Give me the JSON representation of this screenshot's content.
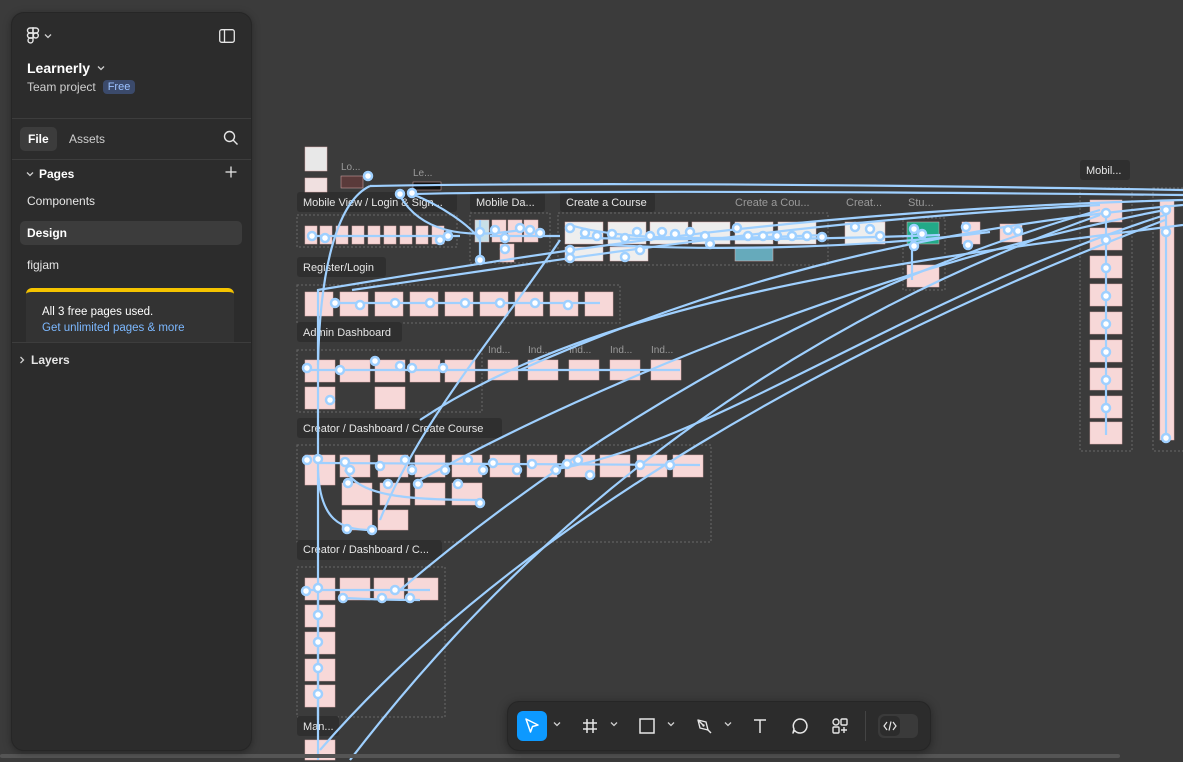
{
  "sidebar": {
    "project_name": "Learnerly",
    "project_type": "Team project",
    "plan_badge": "Free",
    "tabs": [
      {
        "label": "File"
      },
      {
        "label": "Assets"
      }
    ],
    "pages_title": "Pages",
    "pages": [
      {
        "label": "Components"
      },
      {
        "label": "Design"
      },
      {
        "label": "figjam"
      }
    ],
    "active_page": "Design",
    "upsell": {
      "message": "All 3 free pages used.",
      "link": "Get unlimited pages & more"
    },
    "layers_title": "Layers"
  },
  "canvas": {
    "background": "#3b3b3b",
    "flow_color": "#9fd0ff",
    "frame_fill": "#f7d8d8",
    "sections": [
      {
        "title": "Mobile View / Login & Sign..."
      },
      {
        "title": "Mobile Da..."
      },
      {
        "title": "Create a Course"
      },
      {
        "title": "Create a Cou..."
      },
      {
        "title": "Creat..."
      },
      {
        "title": "Stu..."
      },
      {
        "title": "Register/Login"
      },
      {
        "title": "Admin Dashboard"
      },
      {
        "title": "Creator / Dashboard / Create Course"
      },
      {
        "title": "Creator / Dashboard / C..."
      },
      {
        "title": "Man..."
      },
      {
        "title": "Mobil..."
      }
    ],
    "frame_labels": [
      {
        "text": "Lo..."
      },
      {
        "text": "Le..."
      },
      {
        "text": "Ind..."
      },
      {
        "text": "Ind..."
      },
      {
        "text": "Ind..."
      },
      {
        "text": "Ind..."
      },
      {
        "text": "Ind..."
      }
    ]
  },
  "toolbar": {
    "tools": [
      {
        "name": "Move"
      },
      {
        "name": "Frame"
      },
      {
        "name": "Rectangle"
      },
      {
        "name": "Pen"
      },
      {
        "name": "Text"
      },
      {
        "name": "Comment"
      },
      {
        "name": "Actions"
      }
    ],
    "active_tool": "Move",
    "accent": "#0d99ff"
  }
}
